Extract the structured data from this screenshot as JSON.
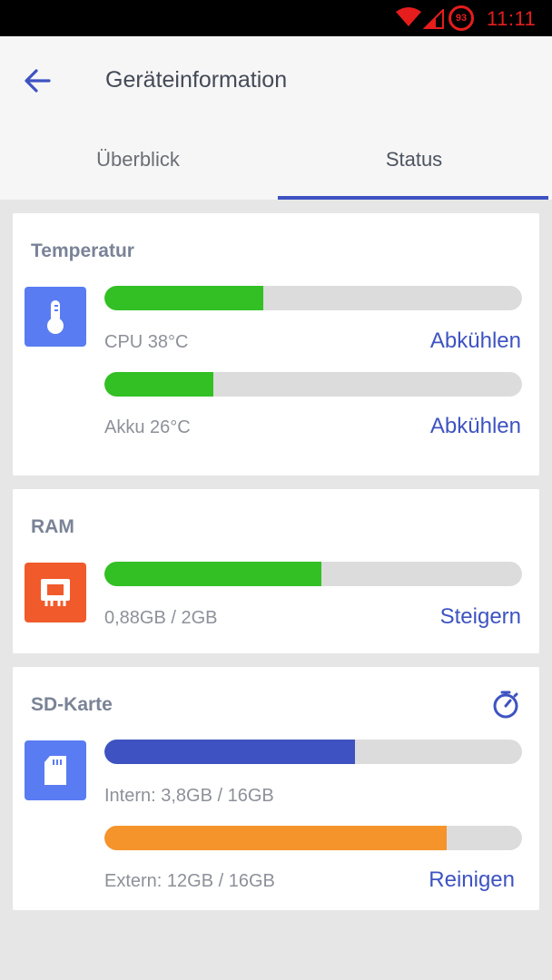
{
  "statusbar": {
    "time": "11:11",
    "battery": "93",
    "accent": "#e51d1d"
  },
  "appbar": {
    "title": "Geräteinformation",
    "back_icon": "arrow-left-icon"
  },
  "tabs": [
    {
      "label": "Überblick"
    },
    {
      "label": "Status",
      "selected": true
    }
  ],
  "colors": {
    "accent": "#3e53c1",
    "green": "#32c024",
    "orange": "#f5942a",
    "blue": "#3e53c1",
    "track": "#dcdcdc"
  },
  "temperature": {
    "title": "Temperatur",
    "icon": "thermometer-icon",
    "items": [
      {
        "label": "CPU 38°C",
        "action": "Abkühlen",
        "level": 0.38
      },
      {
        "label": "Akku 26°C",
        "action": "Abkühlen",
        "level": 0.26
      }
    ]
  },
  "ram": {
    "title": "RAM",
    "icon": "memory-chip-icon",
    "label": "0,88GB / 2GB",
    "action": "Steigern",
    "level": 0.52
  },
  "sd": {
    "title": "SD-Karte",
    "icon": "sd-card-icon",
    "timer_icon": "stopwatch-icon",
    "items": [
      {
        "label": "Intern: 3,8GB / 16GB",
        "level": 0.6
      },
      {
        "label": "Extern: 12GB / 16GB",
        "level": 0.82
      }
    ],
    "action": "Reinigen"
  }
}
